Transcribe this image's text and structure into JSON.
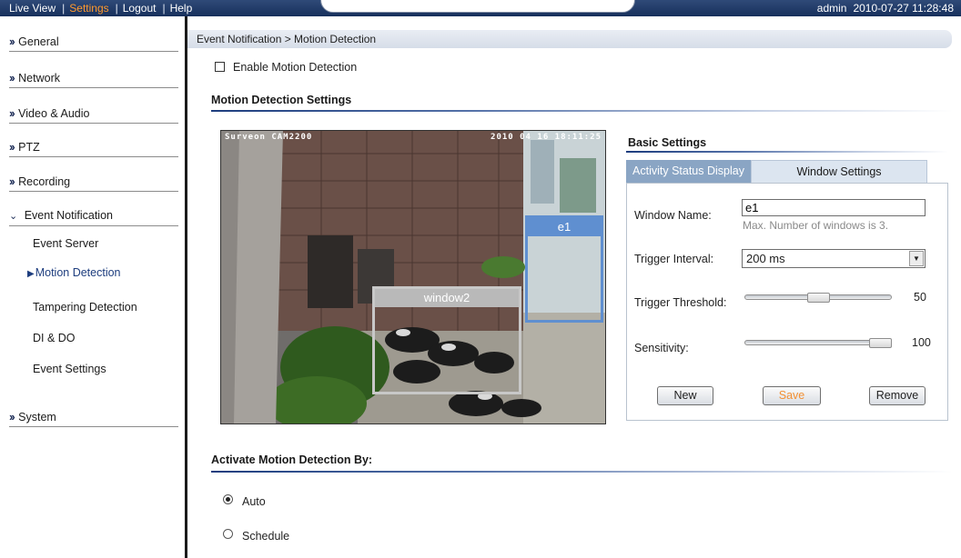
{
  "topbar": {
    "nav": [
      "Live View",
      "Settings",
      "Logout",
      "Help"
    ],
    "active": "Settings",
    "user": "admin",
    "datetime": "2010-07-27 11:28:48"
  },
  "sidebar": {
    "categories": [
      {
        "label": "General"
      },
      {
        "label": "Network"
      },
      {
        "label": "Video & Audio"
      },
      {
        "label": "PTZ"
      },
      {
        "label": "Recording"
      },
      {
        "label": "Event Notification"
      },
      {
        "label": "System"
      }
    ],
    "event_items": [
      {
        "label": "Event Server"
      },
      {
        "label": "Motion Detection"
      },
      {
        "label": "Tampering Detection"
      },
      {
        "label": "DI & DO"
      },
      {
        "label": "Event Settings"
      }
    ]
  },
  "breadcrumb": "Event Notification > Motion Detection",
  "enable_label": "Enable Motion Detection",
  "enable_checked": false,
  "section_motion": "Motion Detection Settings",
  "camera": {
    "osd_left": "Surveon CAM2200",
    "osd_right": "2010 04 16 18:11:25",
    "windows": [
      {
        "name": "window2",
        "color": "#c8c8c8"
      },
      {
        "name": "e1",
        "color": "#5f8fd0"
      }
    ]
  },
  "basic": {
    "title": "Basic Settings",
    "tabs": [
      "Activity Status Display",
      "Window Settings"
    ],
    "active_tab": "Window Settings",
    "window_name_label": "Window Name:",
    "window_name_value": "e1",
    "window_hint": "Max. Number of windows is 3.",
    "interval_label": "Trigger Interval:",
    "interval_value": "200 ms",
    "threshold_label": "Trigger Threshold:",
    "threshold_value": "50",
    "sensitivity_label": "Sensitivity:",
    "sensitivity_value": "100",
    "buttons": {
      "new": "New",
      "save": "Save",
      "remove": "Remove"
    }
  },
  "section_activate": "Activate Motion Detection By:",
  "activate_options": [
    {
      "label": "Auto",
      "checked": true
    },
    {
      "label": "Schedule",
      "checked": false
    }
  ],
  "colors": {
    "topbar": "#17305c",
    "active_nav": "#ff9a2e",
    "tab_active": "#8aa5c4",
    "save_text": "#f29033"
  }
}
